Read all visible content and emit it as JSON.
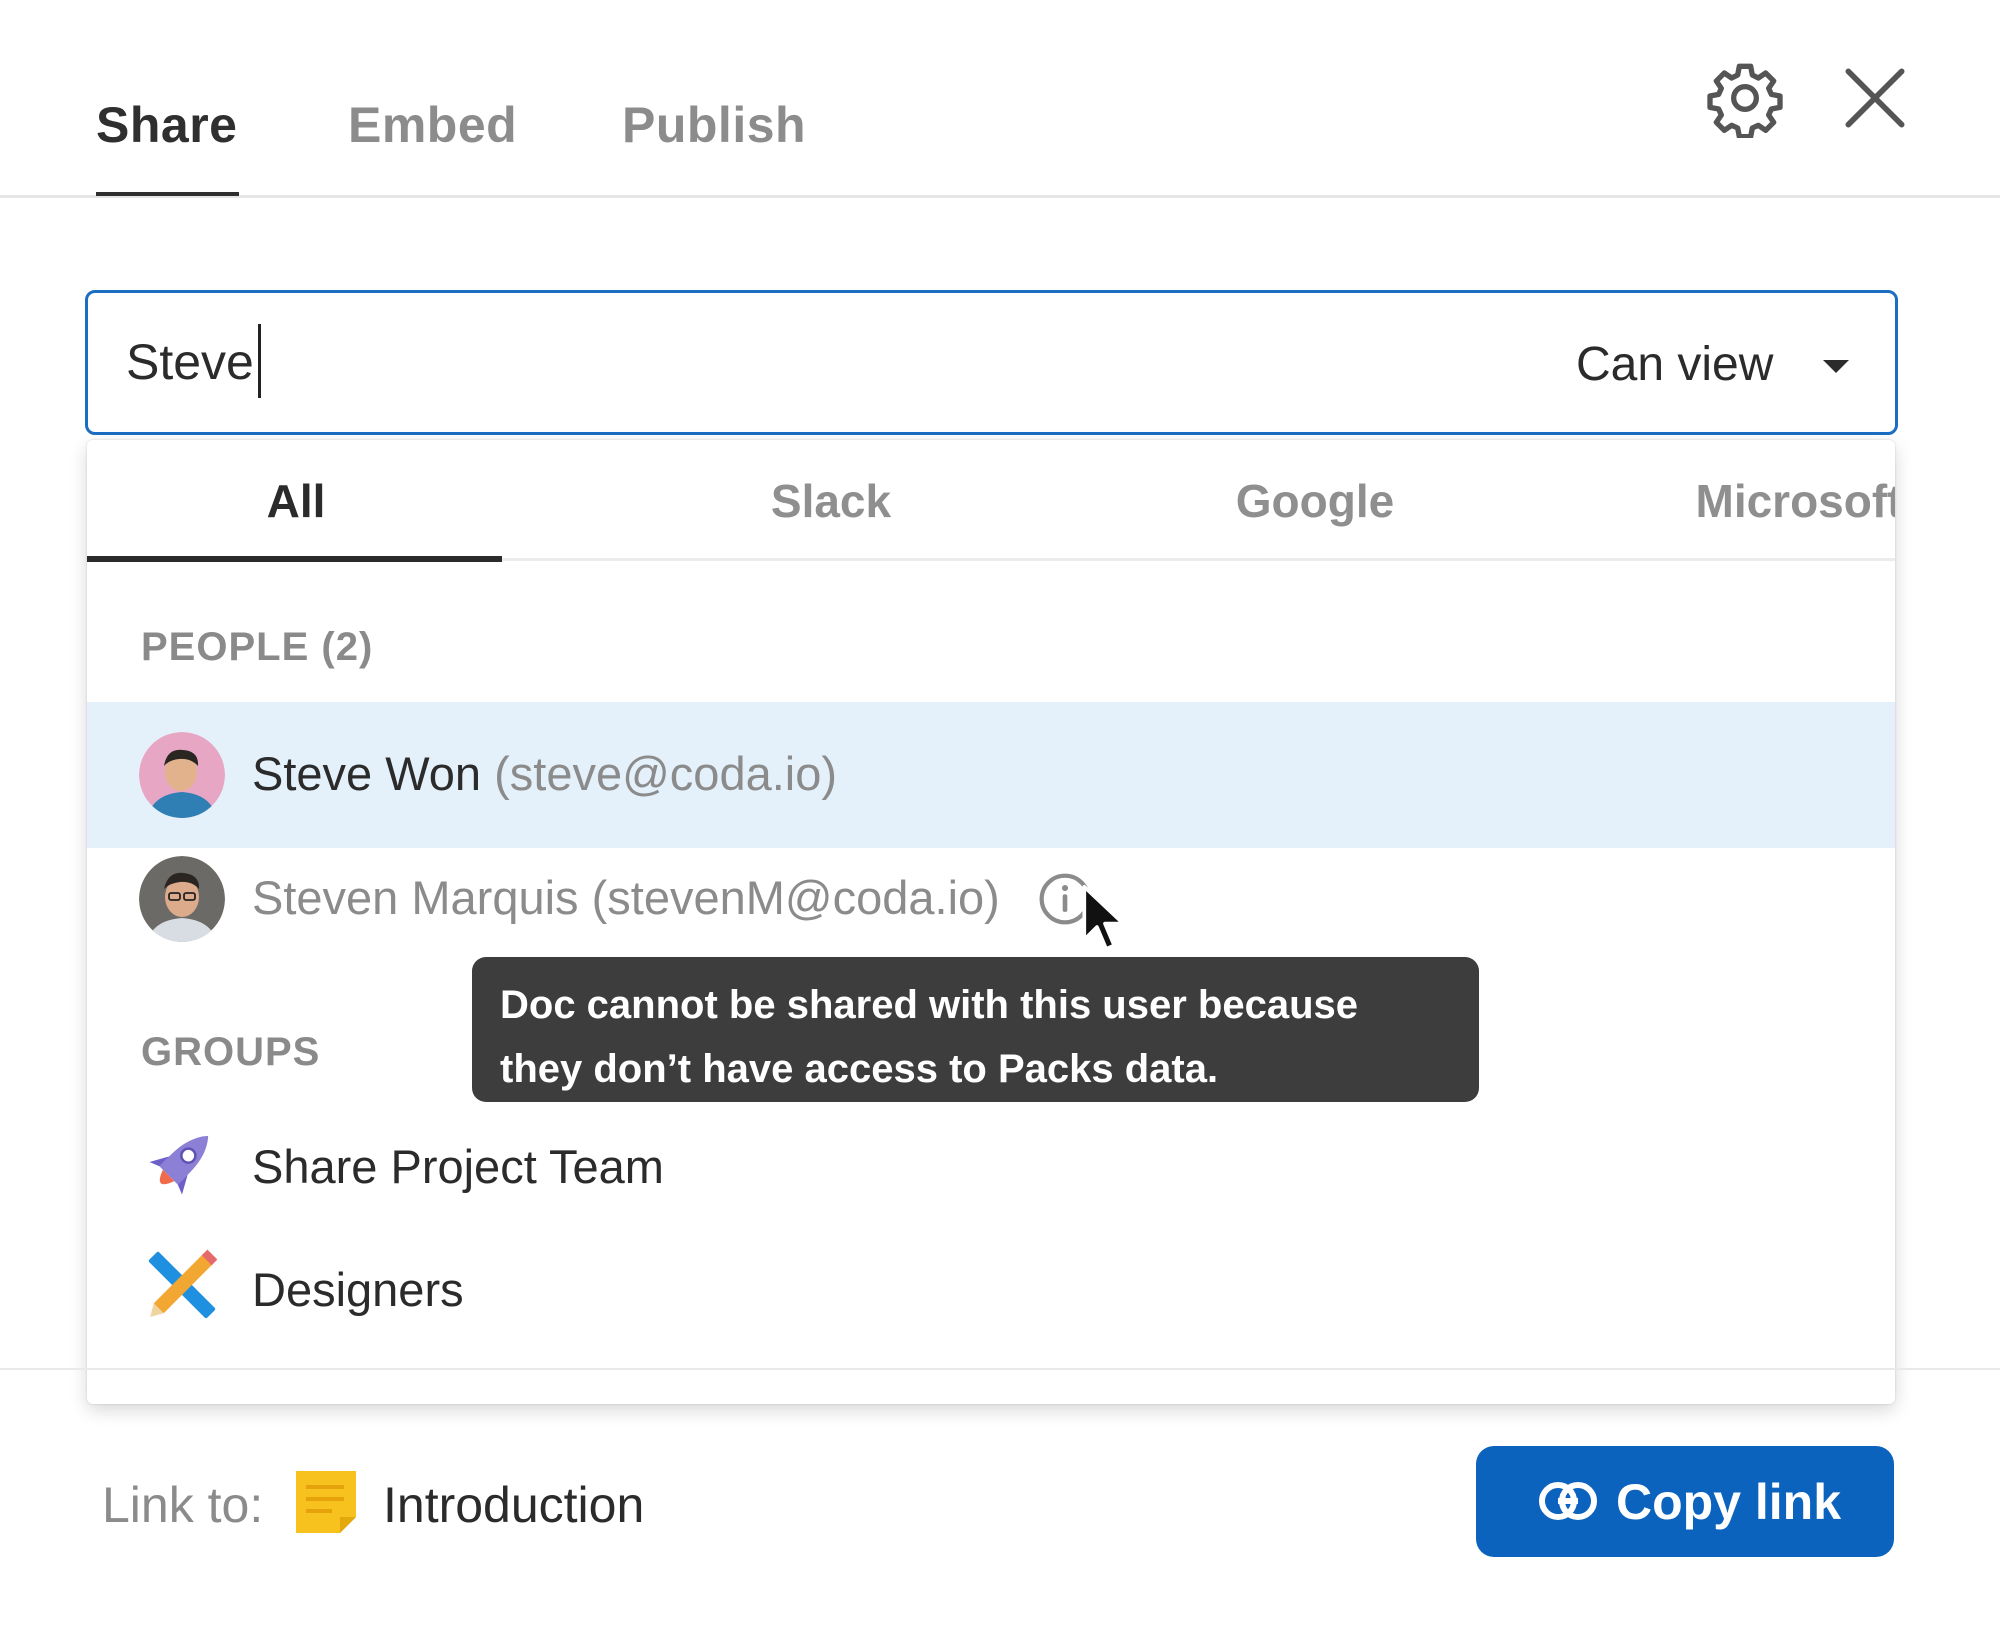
{
  "header": {
    "tabs": [
      {
        "label": "Share",
        "active": true
      },
      {
        "label": "Embed",
        "active": false
      },
      {
        "label": "Publish",
        "active": false
      }
    ],
    "icons": [
      "gear-icon",
      "close-icon"
    ]
  },
  "search": {
    "value": "Steve",
    "permission": "Can view"
  },
  "dropdown": {
    "tabs": [
      {
        "label": "All",
        "active": true
      },
      {
        "label": "Slack",
        "active": false
      },
      {
        "label": "Google",
        "active": false
      },
      {
        "label": "Microsoft",
        "active": false
      }
    ],
    "people_header": "PEOPLE (2)",
    "people": [
      {
        "name": "Steve Won",
        "email": "(steve@coda.io)",
        "highlighted": true,
        "disabled": false
      },
      {
        "name": "Steven Marquis",
        "email": "(stevenM@coda.io)",
        "highlighted": false,
        "disabled": true
      }
    ],
    "groups_header": "GROUPS",
    "groups": [
      {
        "name": "Share Project Team",
        "icon": "rocket-icon"
      },
      {
        "name": "Designers",
        "icon": "ruler-pencil-icon"
      }
    ]
  },
  "tooltip": {
    "text": "Doc cannot be shared with this user because they don’t have access to Packs data."
  },
  "footer": {
    "link_label": "Link to:",
    "link_target": "Introduction",
    "copy_button": "Copy link"
  },
  "colors": {
    "accent": "#1b6ec2",
    "button": "#0b63be",
    "highlight_row": "#e4f1fb",
    "tooltip_bg": "#3d3d3d"
  }
}
